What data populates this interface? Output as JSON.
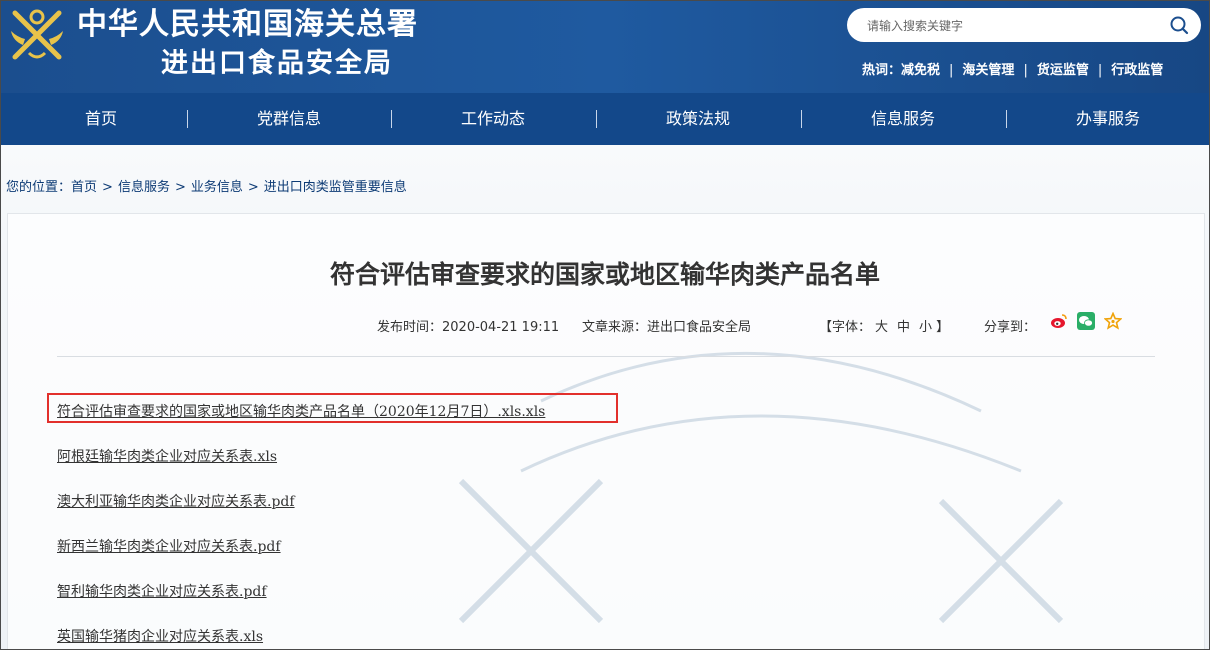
{
  "header": {
    "title_line1": "中华人民共和国海关总署",
    "title_line2": "进出口食品安全局",
    "search": {
      "placeholder": "请输入搜索关键字"
    },
    "hot": {
      "label": "热词：",
      "items": [
        "减免税",
        "海关管理",
        "货运监管",
        "行政监管"
      ],
      "separator": "|"
    }
  },
  "nav": {
    "items": [
      "首页",
      "党群信息",
      "工作动态",
      "政策法规",
      "信息服务",
      "办事服务"
    ],
    "separator": "|"
  },
  "breadcrumb": {
    "prefix": "您的位置：",
    "items": [
      "首页",
      "信息服务",
      "业务信息",
      "进出口肉类监管重要信息"
    ],
    "separator": ">"
  },
  "article": {
    "title": "符合评估审查要求的国家或地区输华肉类产品名单",
    "publish_time": "发布时间：2020-04-21 19:11",
    "source": "文章来源：进出口食品安全局",
    "font_size": {
      "open": "【字体：",
      "large": "大",
      "medium": "中",
      "small": "小",
      "close": "】"
    },
    "share_label": "分享到：",
    "share_icons": [
      "weibo-icon",
      "wechat-icon",
      "favorite-star-icon"
    ],
    "files": [
      "符合评估审查要求的国家或地区输华肉类产品名单（2020年12月7日）.xls.xls",
      "阿根廷输华肉类企业对应关系表.xls",
      "澳大利亚输华肉类企业对应关系表.pdf",
      "新西兰输华肉类企业对应关系表.pdf",
      "智利输华肉类企业对应关系表.pdf",
      "英国输华猪肉企业对应关系表.xls"
    ]
  },
  "colors": {
    "header_blue": "#1b4e8e",
    "nav_blue": "#13488a",
    "highlight_red": "#e2302c",
    "link_blue": "#0d3b75"
  }
}
